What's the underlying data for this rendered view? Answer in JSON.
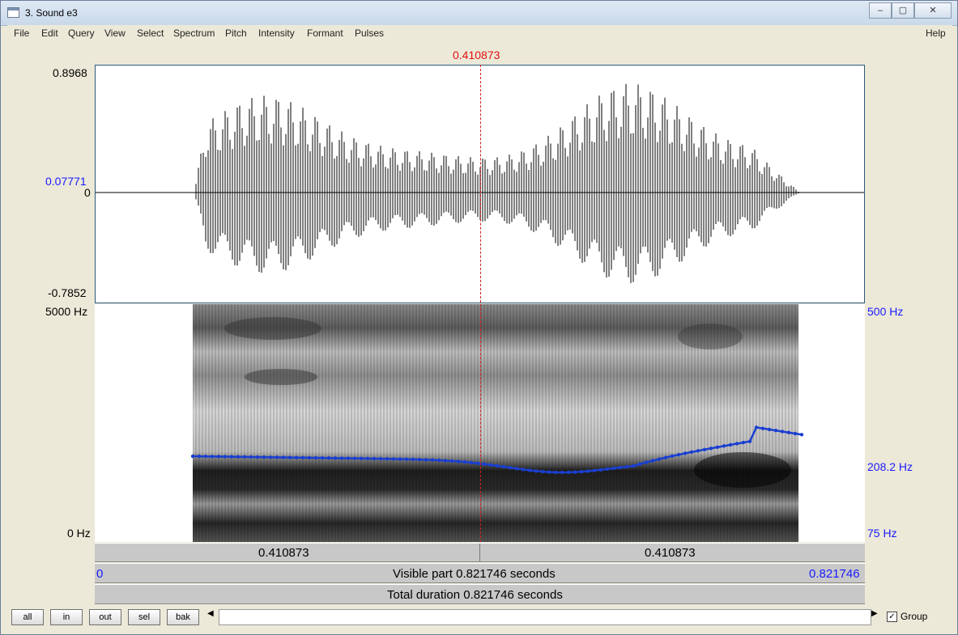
{
  "window": {
    "title": "3. Sound e3",
    "minimize_label": "–",
    "restore_label": "▢",
    "close_label": "✕"
  },
  "menu": {
    "items": [
      "File",
      "Edit",
      "Query",
      "View",
      "Select",
      "Spectrum",
      "Pitch",
      "Intensity",
      "Formant",
      "Pulses"
    ],
    "help": "Help"
  },
  "cursor": {
    "time_label": "0.410873"
  },
  "waveform": {
    "max_label": "0.8968",
    "mid_label": "0.07771",
    "zero_label": "0",
    "min_label": "-0.7852"
  },
  "spectrogram": {
    "top_freq_label": "5000 Hz",
    "bottom_freq_label": "0 Hz"
  },
  "pitch": {
    "top_label": "500 Hz",
    "cursor_label": "208.2 Hz",
    "bottom_label": "75 Hz",
    "color": "#1a3fd0"
  },
  "bars": {
    "left_segment": "0.410873",
    "right_segment": "0.410873",
    "visible_start": "0",
    "visible_text": "Visible part 0.821746 seconds",
    "visible_end": "0.821746",
    "total_text": "Total duration 0.821746 seconds"
  },
  "zoom_buttons": [
    "all",
    "in",
    "out",
    "sel",
    "bak"
  ],
  "scrollbar": {
    "left_arrow": "◀",
    "right_arrow": "▶"
  },
  "group": {
    "label": "Group",
    "checked": true,
    "check_mark": "✓"
  }
}
